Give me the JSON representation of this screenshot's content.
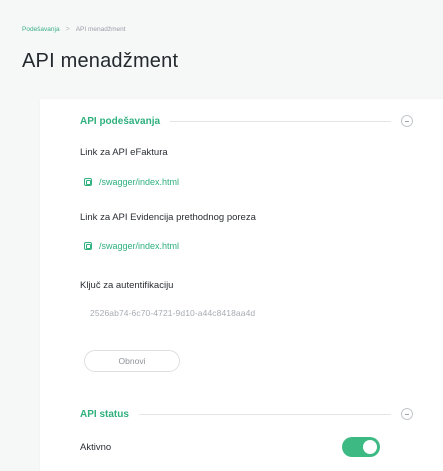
{
  "breadcrumb": {
    "items": [
      "Podešavanja",
      "API menadžment"
    ],
    "separator": ">"
  },
  "page": {
    "title": "API menadžment"
  },
  "api_settings": {
    "title": "API podešavanja",
    "efaktura": {
      "label": "Link za API eFaktura",
      "link": "/swagger/index.html"
    },
    "evidencija": {
      "label": "Link za API Evidencija prethodnog poreza",
      "link": "/swagger/index.html"
    },
    "auth_key": {
      "label": "Ključ za autentifikaciju",
      "value": "2526ab74-6c70-4721-9d10-a44c8418aa4d"
    },
    "renew_button": "Obnovi"
  },
  "api_status": {
    "title": "API status",
    "active_label": "Aktivno",
    "active": true
  },
  "colors": {
    "accent": "#2fb07d",
    "toggle_on": "#3dba83",
    "background": "#f6f7f7"
  },
  "icons": {
    "link": "copy-link-icon",
    "collapse": "collapse-icon"
  }
}
